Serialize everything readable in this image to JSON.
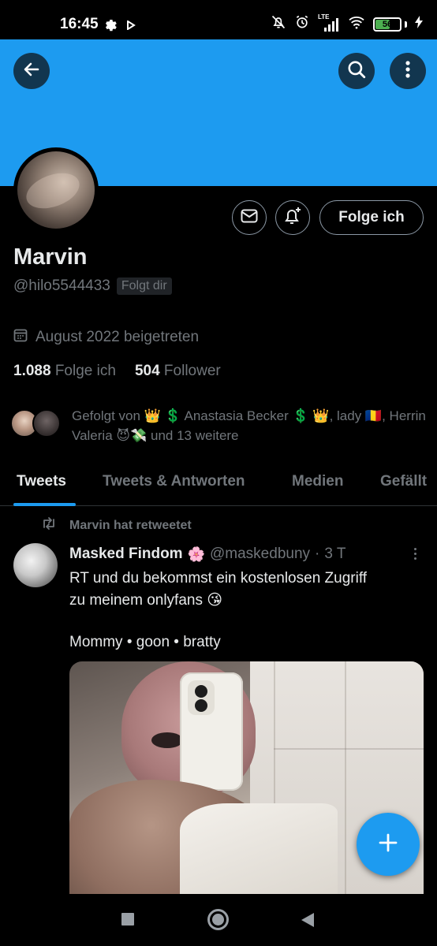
{
  "status_bar": {
    "time": "16:45",
    "network": "LTE",
    "battery": "56",
    "icons": [
      "gear-icon",
      "play-icon",
      "bell-off-icon",
      "alarm-icon",
      "signal-icon",
      "wifi-icon",
      "battery-icon",
      "charging-icon"
    ]
  },
  "header": {
    "banner_color": "#1d9bf0",
    "icons": [
      "back-arrow-icon",
      "search-icon",
      "more-vertical-icon"
    ]
  },
  "profile": {
    "name": "Marvin",
    "handle": "@hilo5544433",
    "follows_you": "Folgt dir",
    "joined": "August 2022 beigetreten",
    "following_count": "1.088",
    "following_label": "Folge ich",
    "followers_count": "504",
    "followers_label": "Follower",
    "follow_button": "Folge ich",
    "followed_by": "Gefolgt von 👑 💲 Anastasia Becker 💲 👑, lady 🇷🇴, Herrin Valeria 😈💸 und 13 weitere"
  },
  "tabs": [
    "Tweets",
    "Tweets & Antworten",
    "Medien",
    "Gefällt"
  ],
  "tweet": {
    "retweet_label": "Marvin hat retweetet",
    "author": "Masked Findom",
    "author_emoji": "🌸",
    "handle": "@maskedbuny",
    "separator": "·",
    "time": "3 T",
    "text_line1": "RT und du bekommst ein kostenlosen Zugriff",
    "text_line2": "zu meinem onlyfans 😘",
    "tags": "Mommy • goon • bratty"
  },
  "fab": {
    "icon": "plus-icon"
  },
  "nav": {
    "icons": [
      "recents-square-icon",
      "home-circle-icon",
      "back-triangle-icon"
    ]
  },
  "colors": {
    "accent": "#1d9bf0",
    "background": "#000000",
    "text": "#e7e9ea",
    "muted": "#71767b"
  }
}
